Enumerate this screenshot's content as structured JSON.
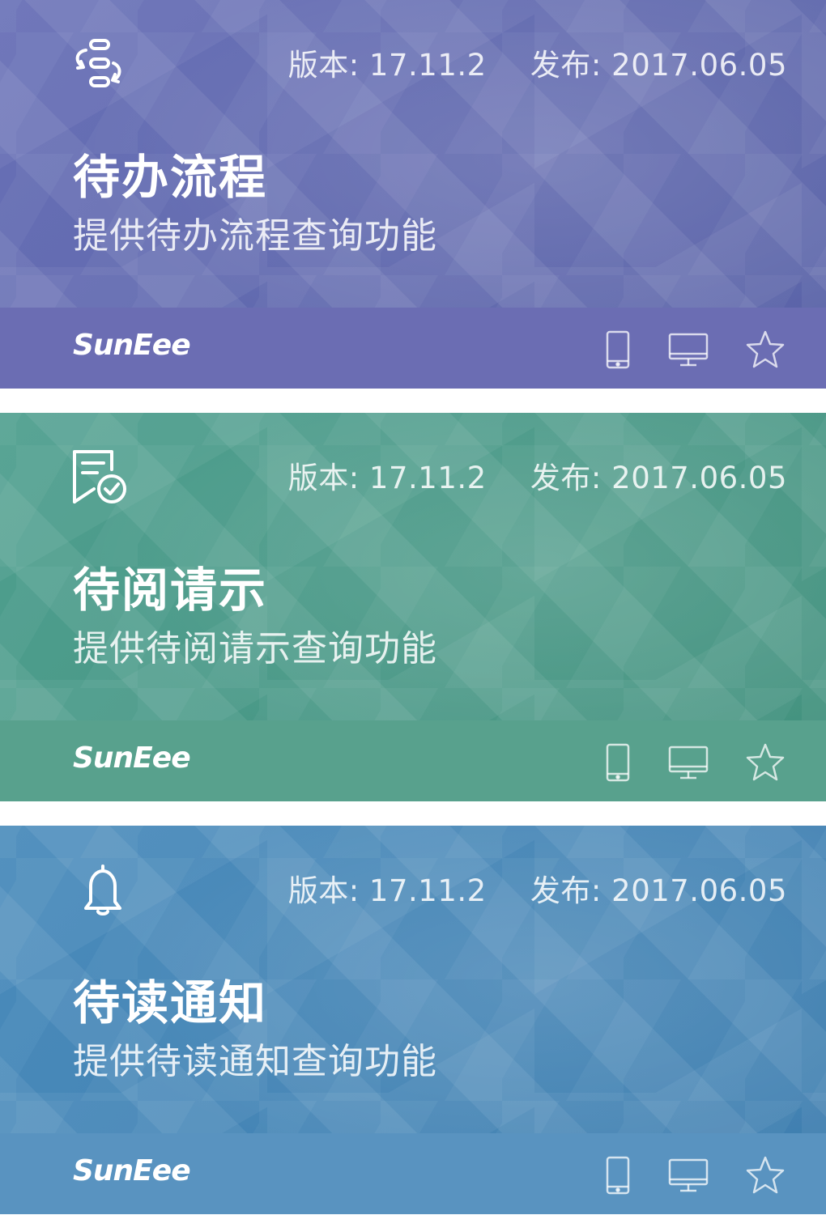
{
  "cards": [
    {
      "icon": "workflow-sync-icon",
      "version": "版本: 17.11.2",
      "published": "发布: 2017.06.05",
      "title": "待办流程",
      "subtitle": "提供待办流程查询功能",
      "brand": "SunEee",
      "colors": {
        "bg": "#6870b6",
        "bg2": "#5a63a8",
        "footer": "#6b6db3"
      }
    },
    {
      "icon": "document-check-icon",
      "version": "版本: 17.11.2",
      "published": "发布: 2017.06.05",
      "title": "待阅请示",
      "subtitle": "提供待阅请示查询功能",
      "brand": "SunEee",
      "colors": {
        "bg": "#4f9f8f",
        "bg2": "#43927f",
        "footer": "#58a18d"
      }
    },
    {
      "icon": "bell-icon",
      "version": "版本: 17.11.2",
      "published": "发布: 2017.06.05",
      "title": "待读通知",
      "subtitle": "提供待读通知查询功能",
      "brand": "SunEee",
      "colors": {
        "bg": "#4a8bbb",
        "bg2": "#3f7fb0",
        "footer": "#5993c0"
      }
    }
  ],
  "footer_icons": [
    "mobile-icon",
    "desktop-icon",
    "star-icon"
  ]
}
